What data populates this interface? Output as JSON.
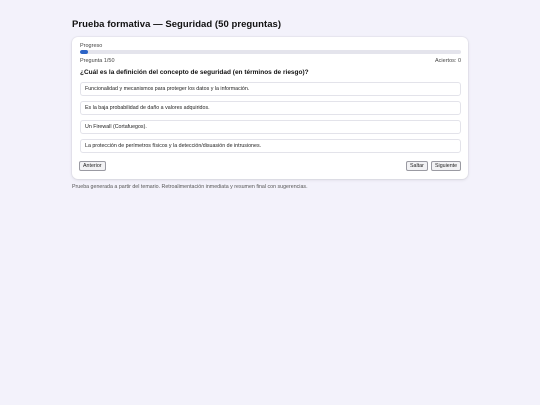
{
  "header": {
    "title": "Prueba formativa — Seguridad (50 preguntas)"
  },
  "quiz": {
    "progress_label": "Progreso",
    "progress_fraction": 0.02,
    "question_counter": "Pregunta 1/50",
    "correct_counter": "Aciertos: 0",
    "question": "¿Cuál es la definición del concepto de seguridad (en términos de riesgo)?",
    "options": [
      "Funcionalidad y mecanismos para proteger los datos y la información.",
      "Es la baja probabilidad de daño a valores adquiridos.",
      "Un Firewall (Cortafuegos).",
      "La protección de perímetros físicos y la detección/disuasión de intrusiones."
    ],
    "buttons": {
      "prev": "Anterior",
      "skip": "Saltar",
      "next": "Siguiente"
    }
  },
  "footer": {
    "note": "Prueba generada a partir del temario. Retroalimentación inmediata y resumen final con sugerencias."
  },
  "colors": {
    "background": "#f3f2fb",
    "progress_fill": "#2b63c6"
  }
}
